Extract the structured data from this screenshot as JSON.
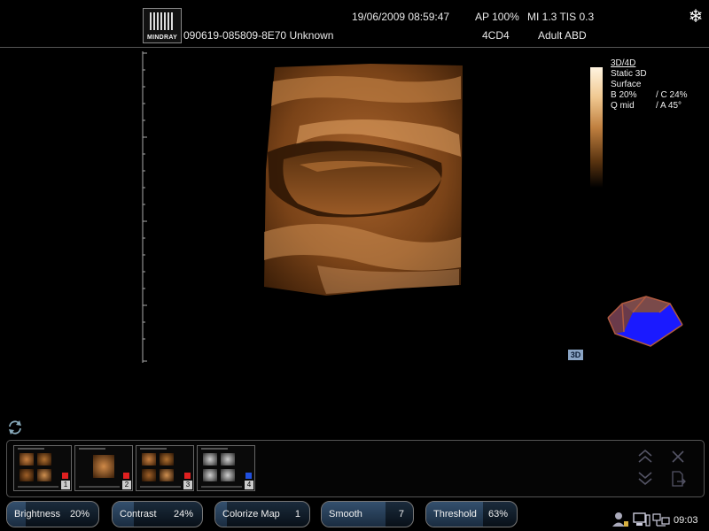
{
  "header": {
    "logo_text": "MINDRAY",
    "patient_id": "090619-085809-8E70 Unknown",
    "datetime": "19/06/2009 08:59:47",
    "acoustic_power": "AP  100%",
    "indices": "MI 1.3 TIS 0.3",
    "probe": "4CD4",
    "preset": "Adult ABD",
    "freeze_icon": "snowflake-icon"
  },
  "info": {
    "mode": "3D/4D",
    "static": "Static 3D",
    "render": "Surface",
    "brightness": "B 20%",
    "contrast": "/ C 24%",
    "quality": "Q mid",
    "angle": "/ A 45°"
  },
  "badge_3d": "3D",
  "thumbnails": [
    {
      "number": "1",
      "marker_color": "#e02020"
    },
    {
      "number": "2",
      "marker_color": "#e02020"
    },
    {
      "number": "3",
      "marker_color": "#e02020"
    },
    {
      "number": "4",
      "marker_color": "#2050e0"
    }
  ],
  "controls": [
    {
      "label": "Brightness",
      "value": "20%",
      "level": 0.2
    },
    {
      "label": "Contrast",
      "value": "24%",
      "level": 0.24
    },
    {
      "label": "Colorize Map",
      "value": "1",
      "level": 0.12
    },
    {
      "label": "Smooth",
      "value": "7",
      "level": 0.7
    },
    {
      "label": "Threshold",
      "value": "63%",
      "level": 0.63
    }
  ],
  "status": {
    "clock": "09:03"
  },
  "colors": {
    "accent_blue": "#1a1aff",
    "cube_edge": "#b05a40",
    "sepia": "#c88040"
  }
}
